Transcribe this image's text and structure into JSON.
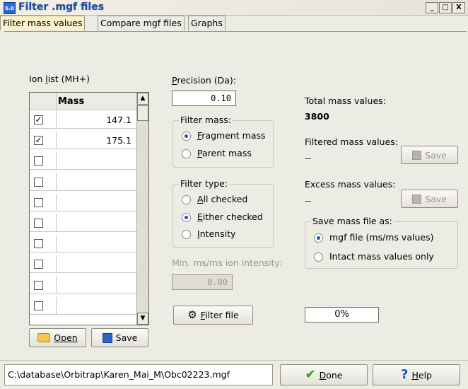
{
  "window": {
    "title": "Filter .mgf files",
    "icon_text": "6.0",
    "controls": [
      "_",
      "□",
      "X"
    ]
  },
  "tabs": [
    {
      "label": "Filter mass values",
      "active": true
    },
    {
      "label": "Compare mgf files",
      "active": false
    },
    {
      "label": "Graphs",
      "active": false
    }
  ],
  "ion_list": {
    "label": "Ion list (MH+)",
    "column_header": "Mass",
    "rows": [
      {
        "checked": true,
        "mass": "147.1"
      },
      {
        "checked": true,
        "mass": "175.1"
      },
      {
        "checked": false,
        "mass": ""
      },
      {
        "checked": false,
        "mass": ""
      },
      {
        "checked": false,
        "mass": ""
      },
      {
        "checked": false,
        "mass": ""
      },
      {
        "checked": false,
        "mass": ""
      },
      {
        "checked": false,
        "mass": ""
      },
      {
        "checked": false,
        "mass": ""
      },
      {
        "checked": false,
        "mass": ""
      }
    ],
    "open_label": "Open",
    "save_label": "Save"
  },
  "precision": {
    "label": "Precision (Da):",
    "value": "0.10"
  },
  "filter_mass": {
    "label": "Filter mass:",
    "options": [
      {
        "label": "Fragment mass",
        "selected": true
      },
      {
        "label": "Parent mass",
        "selected": false
      }
    ]
  },
  "filter_type": {
    "label": "Filter type:",
    "options": [
      {
        "label": "All checked",
        "selected": false
      },
      {
        "label": "Either checked",
        "selected": true
      },
      {
        "label": "Intensity",
        "selected": false
      }
    ]
  },
  "min_intensity": {
    "label": "Min. ms/ms ion intensity:",
    "value": "0.00"
  },
  "filter_button": {
    "label": "Filter file"
  },
  "stats": {
    "total_label": "Total mass values:",
    "total_value": "3800",
    "filtered_label": "Filtered mass values:",
    "filtered_value": "--",
    "excess_label": "Excess mass values:",
    "excess_value": "--",
    "save_label": "Save"
  },
  "save_as": {
    "label": "Save mass file as:",
    "options": [
      {
        "label": "mgf file (ms/ms values)",
        "selected": true
      },
      {
        "label": "Intact mass values only",
        "selected": false
      }
    ]
  },
  "progress": {
    "value": "0%"
  },
  "footer": {
    "path": "C:\\database\\Orbitrap\\Karen_Mai_M\\Obc02223.mgf",
    "done_label": "Done",
    "help_label": "Help"
  },
  "colors": {
    "accent": "#1d55c4",
    "active_tab": "#fbf1c8",
    "window_bg": "#ecebe4"
  }
}
